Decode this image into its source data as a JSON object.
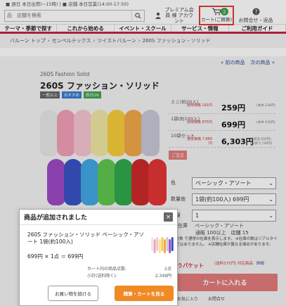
{
  "topbar": {
    "text": "■ 週日 本日出荷(~15時) | ■ 店舗 本日営業(14:00-17:50)"
  },
  "header": {
    "search_placeholder": "品　店舗を検索",
    "account_label": "プレミアム会員 様 アカウント",
    "cart_label": "カート(ご精算)",
    "cart_count": "2",
    "help_label": "お問合せ・返品"
  },
  "nav": {
    "items": [
      {
        "label": "テーマ・季節で探す"
      },
      {
        "label": "これから始める"
      },
      {
        "label": "イベント・スクール"
      },
      {
        "label": "サービス・情報"
      },
      {
        "label": "ご利用ガイド"
      }
    ]
  },
  "breadcrumb": {
    "items": [
      "バルーン トップ",
      "センペルテックス",
      "ツイストバルーン",
      "260S ファッション・ソリッド"
    ]
  },
  "product": {
    "pager_prev": "« 前の商品",
    "pager_next": "次の商品 »",
    "subtitle": "260S Fashion Solid",
    "title": "260S ファッション・ソリッド",
    "badges": [
      {
        "label": "一般以上",
        "color": "#666666"
      },
      {
        "label": "おすすめ",
        "color": "#3a7bd5"
      },
      {
        "label": "即日OK",
        "color": "#3fa34d"
      }
    ],
    "balloon_colors": [
      "#e8e8e8",
      "#f2a0b8",
      "#f6c5d2",
      "#f0e8a4",
      "#f6cd3a",
      "#f1a84a",
      "#c8c8d8",
      "#9f4bc5",
      "#3b52c4",
      "#41a8e2",
      "#5fc84f",
      "#2fa94a",
      "#cc2a2a",
      "#e33535"
    ],
    "prices": [
      {
        "label": "ミニ(約20入)",
        "sale": "通常価格 291円",
        "price": "259円",
        "tax": "(本体 236円)"
      },
      {
        "label": "1袋(約100入)",
        "sale": "通常価格 875円",
        "price": "699円",
        "tax": "(本体 636円)"
      },
      {
        "label": "10袋セット",
        "sale": "通常価格 7,880円",
        "price": "6,303円",
        "tax": "(1袋当 630円) (本体 5,730円)"
      }
    ],
    "notice_label": "ご注文",
    "options": [
      {
        "label": "色",
        "value": "ベーシック・アソート"
      },
      {
        "label": "数量他",
        "value": "1袋(約100入) 699円"
      },
      {
        "label": "数量",
        "value": "1"
      }
    ],
    "stock_label": "在庫",
    "stock_value": "ベーシック・アソート",
    "stock_detail": "通販 100以上　店舗 15",
    "notes": "↑分数 で通常の在庫を表示します。 ※在庫の数はリアルタイムではありません。 ※店舗在庫が異なる場合があります。",
    "ship_label": "ゆうパケット",
    "ship_note": "(送料275円) 対応商品",
    "ship_link": "詳細",
    "add_to_cart": "カートに入れる",
    "fav1": "お気に入り",
    "fav2": "お問合せ"
  },
  "modal": {
    "title": "商品が追加されました",
    "close": "×",
    "item_name": "260S ファッション・ソリッド ベーシック・アソート 1袋(約100入)",
    "qty_line": "699円 × 1点 ＝ 699円",
    "cart_count_label": "カート内の商品点数:",
    "cart_count_value": "2点",
    "subtotal_label": "小計(送料除く):",
    "subtotal_value": "2,349円",
    "continue_button": "お買い物を続ける",
    "checkout_button": "精算・カートを見る"
  }
}
